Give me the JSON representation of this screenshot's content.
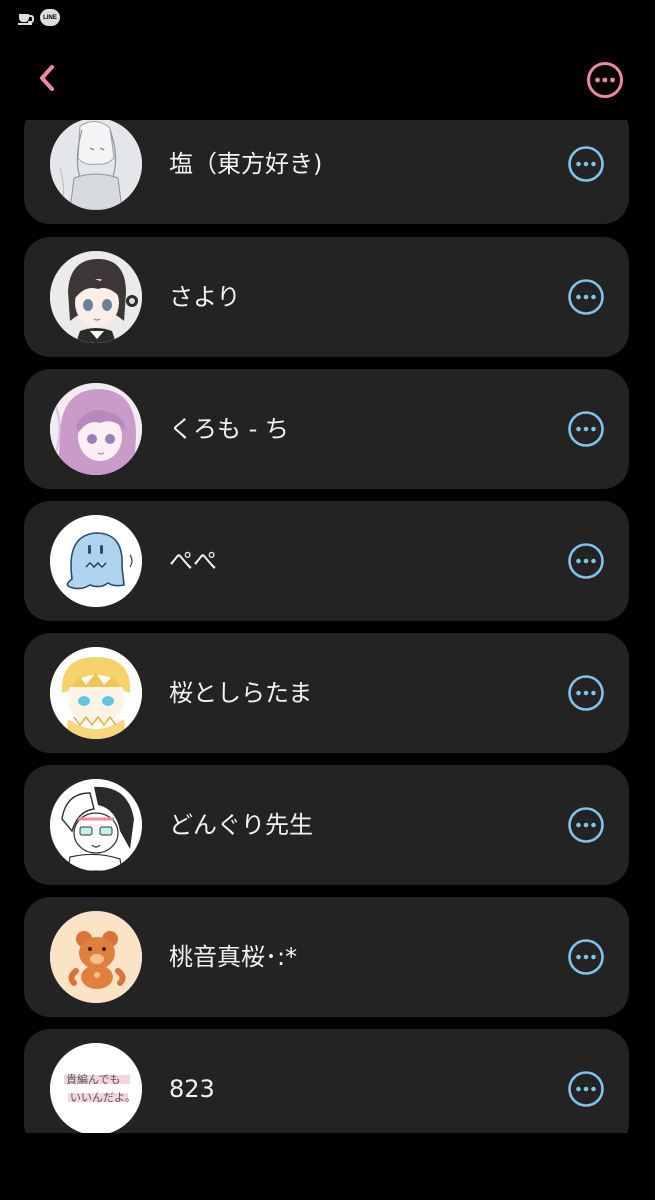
{
  "status_bar": {
    "icons": [
      "coffee-cup-icon",
      "line-app-icon"
    ],
    "line_icon_text": "LINE"
  },
  "header": {
    "back_icon": "chevron-left-icon",
    "more_icon": "more-horizontal-circle-icon"
  },
  "colors": {
    "accent": "#f08a9b",
    "item_more_icon": "#7ec3ea",
    "card_background": "#232323",
    "page_background": "#000000"
  },
  "friends": [
    {
      "name": "塩（東方好き)",
      "avatar": "avatar-sketch-girl-gray"
    },
    {
      "name": "さより",
      "avatar": "avatar-anime-girl-headphones"
    },
    {
      "name": "くろも - ち",
      "avatar": "avatar-anime-girl-pink-hair"
    },
    {
      "name": "ぺぺ",
      "avatar": "avatar-blue-ghost-creature"
    },
    {
      "name": "桜としらたま",
      "avatar": "avatar-blonde-boy-blue-eyes"
    },
    {
      "name": "どんぐり先生",
      "avatar": "avatar-sketch-dark-hair-glasses"
    },
    {
      "name": "桃音真桜･:*",
      "avatar": "avatar-orange-bear"
    },
    {
      "name": "823",
      "avatar": "avatar-handwritten-text"
    }
  ],
  "avatar_823_text": [
    "貴編んでも",
    "いいんだよ。"
  ]
}
